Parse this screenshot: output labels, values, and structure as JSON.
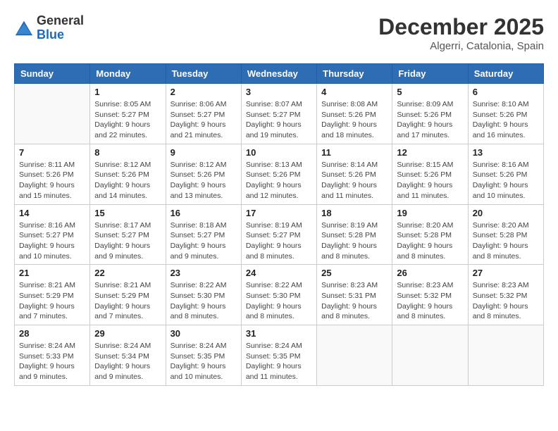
{
  "logo": {
    "general": "General",
    "blue": "Blue"
  },
  "header": {
    "month": "December 2025",
    "location": "Algerri, Catalonia, Spain"
  },
  "weekdays": [
    "Sunday",
    "Monday",
    "Tuesday",
    "Wednesday",
    "Thursday",
    "Friday",
    "Saturday"
  ],
  "weeks": [
    [
      {
        "day": "",
        "info": ""
      },
      {
        "day": "1",
        "info": "Sunrise: 8:05 AM\nSunset: 5:27 PM\nDaylight: 9 hours\nand 22 minutes."
      },
      {
        "day": "2",
        "info": "Sunrise: 8:06 AM\nSunset: 5:27 PM\nDaylight: 9 hours\nand 21 minutes."
      },
      {
        "day": "3",
        "info": "Sunrise: 8:07 AM\nSunset: 5:27 PM\nDaylight: 9 hours\nand 19 minutes."
      },
      {
        "day": "4",
        "info": "Sunrise: 8:08 AM\nSunset: 5:26 PM\nDaylight: 9 hours\nand 18 minutes."
      },
      {
        "day": "5",
        "info": "Sunrise: 8:09 AM\nSunset: 5:26 PM\nDaylight: 9 hours\nand 17 minutes."
      },
      {
        "day": "6",
        "info": "Sunrise: 8:10 AM\nSunset: 5:26 PM\nDaylight: 9 hours\nand 16 minutes."
      }
    ],
    [
      {
        "day": "7",
        "info": "Sunrise: 8:11 AM\nSunset: 5:26 PM\nDaylight: 9 hours\nand 15 minutes."
      },
      {
        "day": "8",
        "info": "Sunrise: 8:12 AM\nSunset: 5:26 PM\nDaylight: 9 hours\nand 14 minutes."
      },
      {
        "day": "9",
        "info": "Sunrise: 8:12 AM\nSunset: 5:26 PM\nDaylight: 9 hours\nand 13 minutes."
      },
      {
        "day": "10",
        "info": "Sunrise: 8:13 AM\nSunset: 5:26 PM\nDaylight: 9 hours\nand 12 minutes."
      },
      {
        "day": "11",
        "info": "Sunrise: 8:14 AM\nSunset: 5:26 PM\nDaylight: 9 hours\nand 11 minutes."
      },
      {
        "day": "12",
        "info": "Sunrise: 8:15 AM\nSunset: 5:26 PM\nDaylight: 9 hours\nand 11 minutes."
      },
      {
        "day": "13",
        "info": "Sunrise: 8:16 AM\nSunset: 5:26 PM\nDaylight: 9 hours\nand 10 minutes."
      }
    ],
    [
      {
        "day": "14",
        "info": "Sunrise: 8:16 AM\nSunset: 5:27 PM\nDaylight: 9 hours\nand 10 minutes."
      },
      {
        "day": "15",
        "info": "Sunrise: 8:17 AM\nSunset: 5:27 PM\nDaylight: 9 hours\nand 9 minutes."
      },
      {
        "day": "16",
        "info": "Sunrise: 8:18 AM\nSunset: 5:27 PM\nDaylight: 9 hours\nand 9 minutes."
      },
      {
        "day": "17",
        "info": "Sunrise: 8:19 AM\nSunset: 5:27 PM\nDaylight: 9 hours\nand 8 minutes."
      },
      {
        "day": "18",
        "info": "Sunrise: 8:19 AM\nSunset: 5:28 PM\nDaylight: 9 hours\nand 8 minutes."
      },
      {
        "day": "19",
        "info": "Sunrise: 8:20 AM\nSunset: 5:28 PM\nDaylight: 9 hours\nand 8 minutes."
      },
      {
        "day": "20",
        "info": "Sunrise: 8:20 AM\nSunset: 5:28 PM\nDaylight: 9 hours\nand 8 minutes."
      }
    ],
    [
      {
        "day": "21",
        "info": "Sunrise: 8:21 AM\nSunset: 5:29 PM\nDaylight: 9 hours\nand 7 minutes."
      },
      {
        "day": "22",
        "info": "Sunrise: 8:21 AM\nSunset: 5:29 PM\nDaylight: 9 hours\nand 7 minutes."
      },
      {
        "day": "23",
        "info": "Sunrise: 8:22 AM\nSunset: 5:30 PM\nDaylight: 9 hours\nand 8 minutes."
      },
      {
        "day": "24",
        "info": "Sunrise: 8:22 AM\nSunset: 5:30 PM\nDaylight: 9 hours\nand 8 minutes."
      },
      {
        "day": "25",
        "info": "Sunrise: 8:23 AM\nSunset: 5:31 PM\nDaylight: 9 hours\nand 8 minutes."
      },
      {
        "day": "26",
        "info": "Sunrise: 8:23 AM\nSunset: 5:32 PM\nDaylight: 9 hours\nand 8 minutes."
      },
      {
        "day": "27",
        "info": "Sunrise: 8:23 AM\nSunset: 5:32 PM\nDaylight: 9 hours\nand 8 minutes."
      }
    ],
    [
      {
        "day": "28",
        "info": "Sunrise: 8:24 AM\nSunset: 5:33 PM\nDaylight: 9 hours\nand 9 minutes."
      },
      {
        "day": "29",
        "info": "Sunrise: 8:24 AM\nSunset: 5:34 PM\nDaylight: 9 hours\nand 9 minutes."
      },
      {
        "day": "30",
        "info": "Sunrise: 8:24 AM\nSunset: 5:35 PM\nDaylight: 9 hours\nand 10 minutes."
      },
      {
        "day": "31",
        "info": "Sunrise: 8:24 AM\nSunset: 5:35 PM\nDaylight: 9 hours\nand 11 minutes."
      },
      {
        "day": "",
        "info": ""
      },
      {
        "day": "",
        "info": ""
      },
      {
        "day": "",
        "info": ""
      }
    ]
  ]
}
